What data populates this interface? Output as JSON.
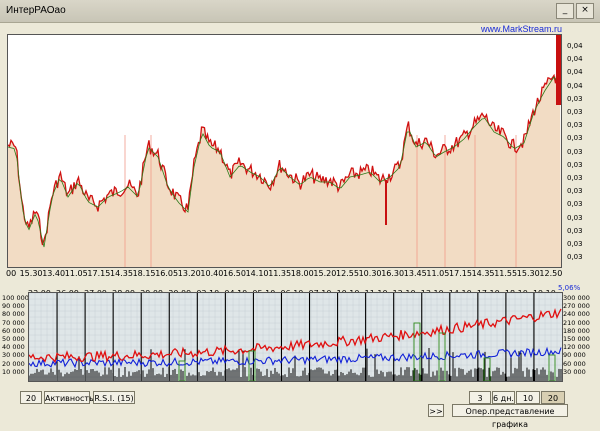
{
  "window": {
    "title": "ИнтерРАОао"
  },
  "brand": "www.MarkStream.ru",
  "main_chart": {
    "y_labels": [
      "0,04",
      "0,04",
      "0,04",
      "0,04",
      "0,03",
      "0,03",
      "0,03",
      "0,03",
      "0,03",
      "0,03",
      "0,03",
      "0,03",
      "0,03",
      "0,03",
      "0,03",
      "0,03",
      "0,03"
    ],
    "x_labels": [
      "00",
      "15.30",
      "13.40",
      "11.05",
      "17.15",
      "14.35",
      "18.15",
      "16.05",
      "13.20",
      "10.40",
      "16.50",
      "14.10",
      "11.35",
      "18.00",
      "15.20",
      "12.55",
      "10.30",
      "16.30",
      "13.45",
      "11.05",
      "17.15",
      "14.35",
      "11.55",
      "15.30",
      "12.50"
    ],
    "fill_color": "#f2dcc4",
    "price_color": "#d01010",
    "avg_color": "#2e7a1a"
  },
  "lower_chart": {
    "percent_label": "5,06%",
    "dates": [
      "23.09",
      "26.09",
      "27.09",
      "28.09",
      "29.09",
      "30.09",
      "03.10",
      "04.10",
      "05.10",
      "06.10",
      "07.10",
      "10.10",
      "11.10",
      "12.10",
      "13.10",
      "14.10",
      "17.10",
      "18.10",
      "19.10"
    ],
    "left_labels": [
      "100 000",
      "90 000",
      "80 000",
      "70 000",
      "60 000",
      "50 000",
      "40 000",
      "30 000",
      "20 000",
      "10 000"
    ],
    "right_labels": [
      "300 000",
      "270 000",
      "240 000",
      "210 000",
      "180 000",
      "150 000",
      "120 000",
      "90 000",
      "60 000",
      "30 000"
    ],
    "colors": {
      "red": "#e01010",
      "blue": "#1020d8",
      "black": "#000000",
      "green": "#2e8a1a",
      "bg": "#dfe6e8"
    }
  },
  "controls": {
    "period": "20",
    "activity": "Активность",
    "rsi": "R.S.I.  (15)",
    "scroll": ">>",
    "days3": "3 дн.",
    "days6": "6 дн.",
    "days10": "10 дн.",
    "days20": "20 дн.",
    "options": "Опер.представление графика"
  }
}
